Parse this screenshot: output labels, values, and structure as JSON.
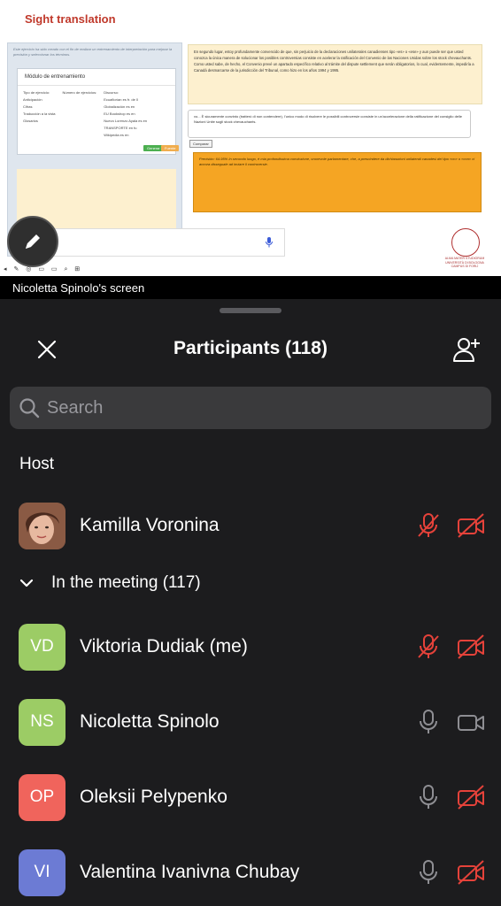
{
  "shared_screen": {
    "slide_title": "Sight translation",
    "intro_text": "Este ejercicio ha sido creado con el fin de realizar un entrenamiento de interpretación para mejorar la precisión y seleccionar los términos.",
    "module_title": "Módulo de entrenamiento",
    "col1_title": "Tipo de ejercicio:",
    "col1_items": [
      "Anticipación",
      "Cifras",
      "Traducción a la vista",
      "Glosarios"
    ],
    "col2_title": "Número de ejercicios:",
    "col3_title": "Discurso:",
    "col3_items": [
      "Ecuaflorían es fr. de 0",
      "Globalización es en",
      "EU Bookshop es en",
      "Nuevo Lorenzo Ayala es en",
      "TRANSPORTE en fu",
      "Wikipedia es en"
    ],
    "btn_left": "Generar",
    "btn_right": "Fuente",
    "text_paragraph": "En segundo lugar, estoy profundamente convencido de que, sin perjuicio de la declaraciones unilaterales canadienses tipo «es» o «ese» y aun puede ser que usted conozca la única manera de solucionar los posibles controversias consiste en acelerar la ratificación del Convenio de las Naciones Unidas sobre los stock chevauchants. Como usted sabe, de hecho, el Convenio prevé un apartado específico relativo al trámite del dispute settlement que serán obligatorios, lo cual, evidentemente, impediría a Canadá desmarcarse de la jurisdicción del Tribunal, como hizo en los años 1994 y 1995.",
    "input_paragraph": "vo... È sicuramente convinto (tratterò di non contendere), l'unico modo di risolvere le possibili controversie consiste in un'accelerazione della ratificazione del consiglio delle Nazioni Unite sugli stock chevauchants.",
    "compare_btn": "Comparar",
    "result_paragraph": "Precisión: 64.95% In secondo luogo, è mia profondissima convinzione, onorevole parlamentare, che, a prescindere da dichiarazioni unilaterali canadesi del tipo «cn» o «cnn» ci ancora disseguale ad inviare il controversie.",
    "university_text": "ALMA MATER STUDIORUM UNIVERSITÀ DI BOLOGNA CAMPUS DI FORLÌ",
    "toolbar_glyphs": "◂ ✎ ◎ ▭ ▭ ⌕ ⊞",
    "screen_owner_label": "Nicoletta Spinolo's screen"
  },
  "sheet": {
    "title": "Participants (118)",
    "search_placeholder": "Search",
    "host_section": "Host",
    "meeting_group": "In the meeting (117)"
  },
  "host": {
    "name": "Kamilla Voronina",
    "mic_muted": true,
    "cam_off": true
  },
  "participants": [
    {
      "initials": "VD",
      "name": "Viktoria Dudiak (me)",
      "color": "#9ccc65",
      "mic_muted": true,
      "cam_off": true
    },
    {
      "initials": "NS",
      "name": "Nicoletta Spinolo",
      "color": "#9ccc65",
      "mic_muted": false,
      "cam_off": false
    },
    {
      "initials": "OP",
      "name": "Oleksii Pelypenko",
      "color": "#f0645c",
      "mic_muted": false,
      "cam_off": true
    },
    {
      "initials": "VI",
      "name": "Valentina Ivanivna Chubay",
      "color": "#6c7bd4",
      "mic_muted": false,
      "cam_off": true
    }
  ],
  "colors": {
    "muted_red": "#e5423a",
    "icon_gray": "#8e8e93",
    "sheet_bg": "#1c1c1e",
    "search_bg": "#3a3a3c"
  }
}
